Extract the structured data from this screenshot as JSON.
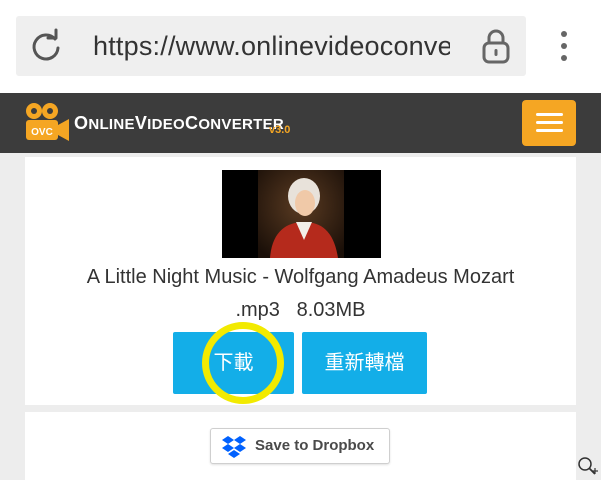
{
  "browser": {
    "url": "https://www.onlinevideoconverter.com",
    "icons": {
      "reload": "reload-icon",
      "lock": "lock-icon",
      "menu": "more-vertical-icon"
    }
  },
  "site": {
    "logo_badge": "OVC",
    "logo_name_parts": [
      "O",
      "NLINE",
      "V",
      "IDEO",
      "C",
      "ONVERTER"
    ],
    "version": "v3.0",
    "accent_color": "#f5a623",
    "menu_icon": "hamburger-menu-icon"
  },
  "result": {
    "title": "A Little Night Music - Wolfgang Amadeus Mozart",
    "format": ".mp3",
    "size": "8.03MB",
    "download_label": "下載",
    "reconvert_label": "重新轉檔",
    "button_color": "#13aee8",
    "highlight_color": "#f2ea00"
  },
  "dropbox": {
    "label": "Save to Dropbox",
    "icon": "dropbox-icon"
  }
}
